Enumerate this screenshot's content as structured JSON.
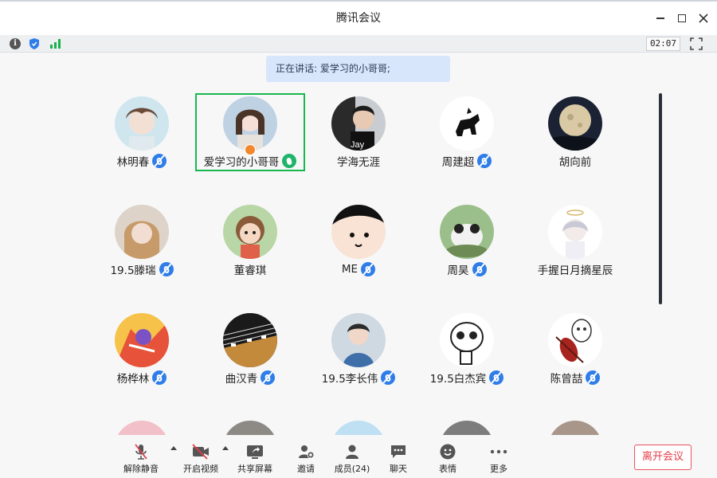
{
  "window": {
    "title": "腾讯会议"
  },
  "infobar": {
    "timer": "02:07"
  },
  "speaking": {
    "text": "正在讲话: 爱学习的小哥哥;"
  },
  "participants": [
    {
      "name": "林明春",
      "mic": "muted"
    },
    {
      "name": "爱学习的小哥哥",
      "mic": "speaking",
      "host": true
    },
    {
      "name": "学海无涯",
      "mic": "none"
    },
    {
      "name": "周建超",
      "mic": "muted"
    },
    {
      "name": "胡向前",
      "mic": "none"
    },
    {
      "name": "19.5滕瑞",
      "mic": "muted"
    },
    {
      "name": "董睿琪",
      "mic": "none"
    },
    {
      "name": "ME",
      "mic": "muted"
    },
    {
      "name": "周昊",
      "mic": "muted"
    },
    {
      "name": "手握日月摘星辰",
      "mic": "none"
    },
    {
      "name": "杨桦林",
      "mic": "muted"
    },
    {
      "name": "曲汉青",
      "mic": "muted"
    },
    {
      "name": "19.5李长伟",
      "mic": "muted"
    },
    {
      "name": "19.5白杰宾",
      "mic": "muted"
    },
    {
      "name": "陈曾喆",
      "mic": "muted"
    }
  ],
  "toolbar": {
    "unmute": "解除静音",
    "video": "开启视频",
    "share": "共享屏幕",
    "invite": "邀请",
    "members": "成员(24)",
    "chat": "聊天",
    "emoji": "表情",
    "more": "更多",
    "leave": "离开会议"
  },
  "colors": {
    "accent_blue": "#2f7de8",
    "speaking_green": "#1fb46a",
    "highlight_border": "#17b84e",
    "leave_red": "#e53d47",
    "banner_bg": "#d8e6fb"
  }
}
